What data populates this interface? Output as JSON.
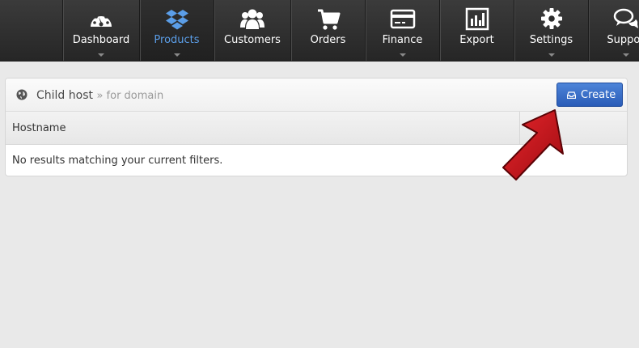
{
  "nav": {
    "items": [
      {
        "label": "Dashboard",
        "icon": "dashboard-gauge-icon"
      },
      {
        "label": "Products",
        "icon": "dropbox-box-icon"
      },
      {
        "label": "Customers",
        "icon": "customers-group-icon"
      },
      {
        "label": "Orders",
        "icon": "cart-icon"
      },
      {
        "label": "Finance",
        "icon": "credit-card-icon"
      },
      {
        "label": "Export",
        "icon": "bar-chart-icon"
      },
      {
        "label": "Settings",
        "icon": "gear-icon"
      },
      {
        "label": "Suppor",
        "icon": "chat-bubbles-icon"
      }
    ],
    "active": "Products",
    "active_color": "#5b9ee8"
  },
  "panel": {
    "title": "Child host",
    "subtitle": "» for domain",
    "create_label": "Create",
    "table": {
      "columns": [
        "Hostname"
      ],
      "empty_message": "No results matching your current filters."
    }
  },
  "colors": {
    "nav_bg": "#2e2e2e",
    "button": "#3a6fcc",
    "arrow": "#c4121a"
  }
}
